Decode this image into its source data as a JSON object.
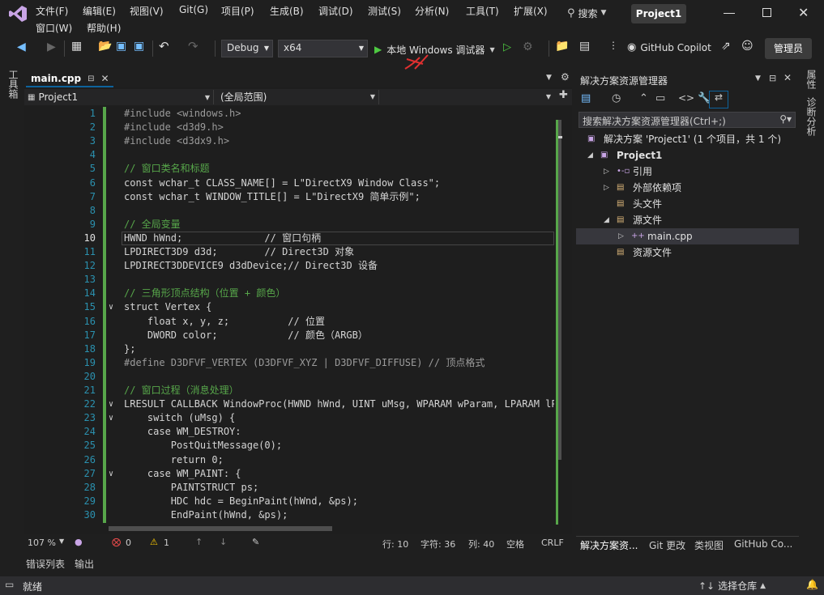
{
  "menu": {
    "file": "文件(F)",
    "edit": "编辑(E)",
    "view": "视图(V)",
    "git": "Git(G)",
    "project": "项目(P)",
    "build": "生成(B)",
    "debug": "调试(D)",
    "test": "测试(S)",
    "analyze": "分析(N)",
    "tools": "工具(T)",
    "extensions": "扩展(X)",
    "window": "窗口(W)",
    "help": "帮助(H)"
  },
  "search_label": "搜索",
  "solution_title": "Project1",
  "toolbar": {
    "config": "Debug",
    "platform": "x64",
    "run_label": "本地 Windows 调试器",
    "copilot": "GitHub Copilot",
    "admin": "管理员"
  },
  "left_rail": {
    "toolbox": "工具箱"
  },
  "right_rail": {
    "properties": "属性",
    "diagnostics": "诊断分析"
  },
  "editor": {
    "tab_label": "main.cpp",
    "project_dropdown": "Project1",
    "scope_dropdown": "(全局范围)",
    "lines": [
      {
        "n": "1",
        "t": "#include <windows.h>"
      },
      {
        "n": "2",
        "t": "#include <d3d9.h>"
      },
      {
        "n": "3",
        "t": "#include <d3dx9.h>"
      },
      {
        "n": "4",
        "t": ""
      },
      {
        "n": "5",
        "t": "// 窗口类名和标题"
      },
      {
        "n": "6",
        "t": "const wchar_t CLASS_NAME[] = L\"DirectX9 Window Class\";"
      },
      {
        "n": "7",
        "t": "const wchar_t WINDOW_TITLE[] = L\"DirectX9 简单示例\";"
      },
      {
        "n": "8",
        "t": ""
      },
      {
        "n": "9",
        "t": "// 全局变量"
      },
      {
        "n": "10",
        "t": "HWND hWnd;              // 窗口句柄"
      },
      {
        "n": "11",
        "t": "LPDIRECT3D9 d3d;        // Direct3D 对象"
      },
      {
        "n": "12",
        "t": "LPDIRECT3DDEVICE9 d3dDevice;// Direct3D 设备"
      },
      {
        "n": "13",
        "t": ""
      },
      {
        "n": "14",
        "t": "// 三角形顶点结构（位置 + 颜色）"
      },
      {
        "n": "15",
        "t": "struct Vertex {"
      },
      {
        "n": "16",
        "t": "    float x, y, z;          // 位置"
      },
      {
        "n": "17",
        "t": "    DWORD color;            // 颜色（ARGB）"
      },
      {
        "n": "18",
        "t": "};"
      },
      {
        "n": "19",
        "t": "#define D3DFVF_VERTEX (D3DFVF_XYZ | D3DFVF_DIFFUSE) // 顶点格式"
      },
      {
        "n": "20",
        "t": ""
      },
      {
        "n": "21",
        "t": "// 窗口过程（消息处理）"
      },
      {
        "n": "22",
        "t": "LRESULT CALLBACK WindowProc(HWND hWnd, UINT uMsg, WPARAM wParam, LPARAM lPara"
      },
      {
        "n": "23",
        "t": "    switch (uMsg) {"
      },
      {
        "n": "24",
        "t": "    case WM_DESTROY:"
      },
      {
        "n": "25",
        "t": "        PostQuitMessage(0);"
      },
      {
        "n": "26",
        "t": "        return 0;"
      },
      {
        "n": "27",
        "t": "    case WM_PAINT: {"
      },
      {
        "n": "28",
        "t": "        PAINTSTRUCT ps;"
      },
      {
        "n": "29",
        "t": "        HDC hdc = BeginPaint(hWnd, &ps);"
      },
      {
        "n": "30",
        "t": "        EndPaint(hWnd, &ps);"
      }
    ],
    "status": {
      "zoom": "107 %",
      "errors": "0",
      "warnings": "1",
      "line": "行: 10",
      "char": "字符: 36",
      "col": "列: 40",
      "indent": "空格",
      "eol": "CRLF"
    }
  },
  "solution_explorer": {
    "title": "解决方案资源管理器",
    "search_placeholder": "搜索解决方案资源管理器(Ctrl+;)",
    "items": [
      {
        "label": "解决方案 'Project1' (1 个项目，共 1 个)"
      },
      {
        "label": "Project1"
      },
      {
        "label": "引用"
      },
      {
        "label": "外部依赖项"
      },
      {
        "label": "头文件"
      },
      {
        "label": "源文件"
      },
      {
        "label": "main.cpp"
      },
      {
        "label": "资源文件"
      }
    ],
    "bottom_tabs": [
      "解决方案资...",
      "Git 更改",
      "类视图",
      "GitHub Co..."
    ]
  },
  "bottom_tabs": {
    "errors": "错误列表",
    "output": "输出"
  },
  "status_bar": {
    "ready": "就绪",
    "repo": "选择仓库"
  },
  "colors": {
    "accent": "#68217a",
    "selection_green": "#57a64a",
    "status_bar": "#2d2d30"
  }
}
